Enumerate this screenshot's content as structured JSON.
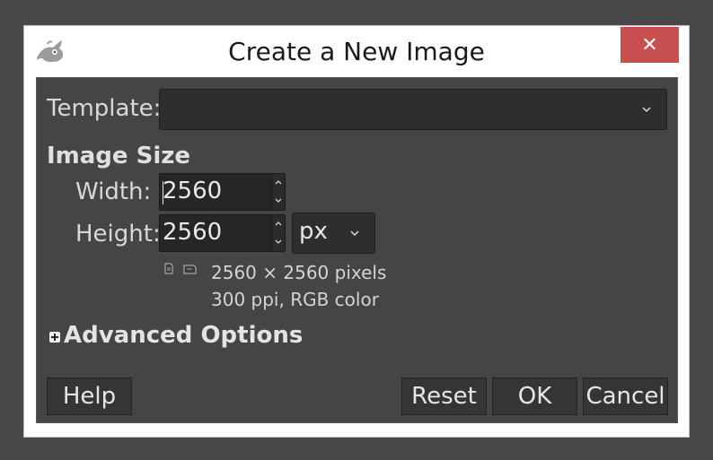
{
  "window": {
    "title": "Create a New Image",
    "close_glyph": "✕",
    "app_icon": "gimp-wilber-icon"
  },
  "template": {
    "label": "Template:",
    "value": ""
  },
  "image_size": {
    "section_title": "Image Size",
    "width_label": "Width:",
    "width_value": "2560",
    "height_label": "Height:",
    "height_value": "2560",
    "unit": "px",
    "summary_dimensions": "2560 × 2560 pixels",
    "summary_resolution": "300 ppi, RGB color",
    "portrait_icon": "portrait-icon",
    "landscape_icon": "landscape-icon"
  },
  "advanced": {
    "label": "Advanced Options",
    "icon": "expand-plus-icon"
  },
  "buttons": {
    "help": "Help",
    "reset": "Reset",
    "ok": "OK",
    "cancel": "Cancel"
  },
  "colors": {
    "background": "#484848",
    "panel": "#454545",
    "field": "#262626",
    "close": "#c74f4f"
  }
}
